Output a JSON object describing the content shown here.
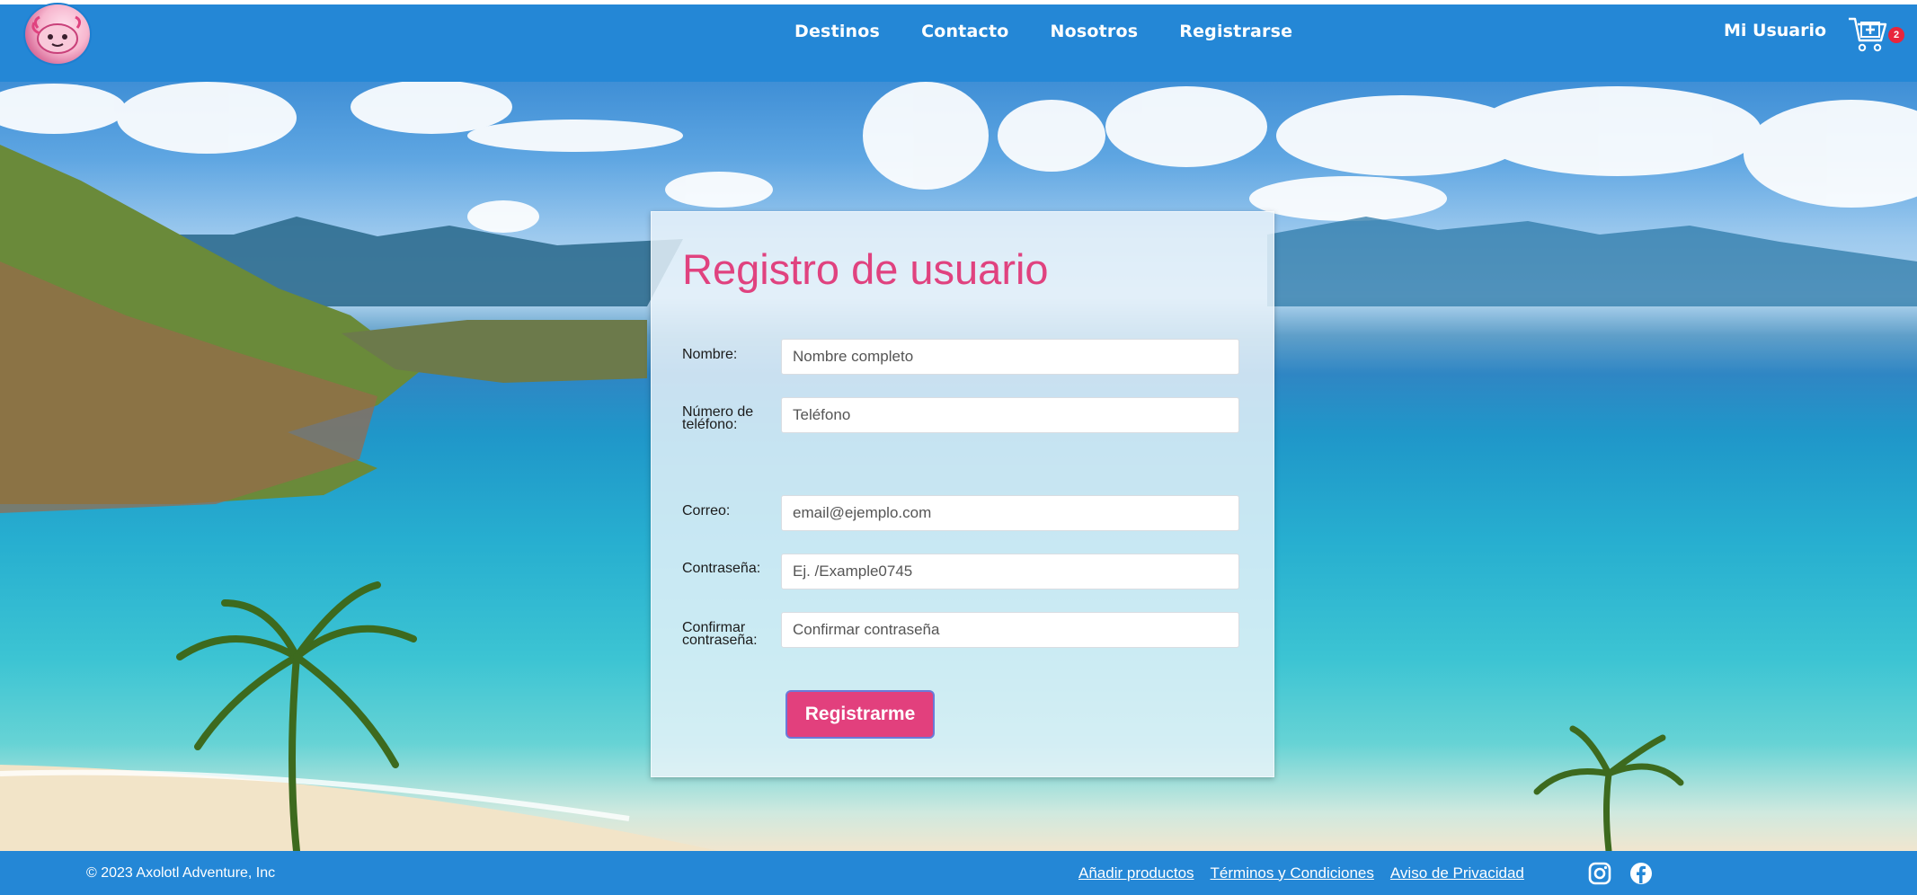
{
  "navbar": {
    "logo_icon": "axolotl-logo-icon",
    "links": [
      {
        "label": "Destinos"
      },
      {
        "label": "Contacto"
      },
      {
        "label": "Nosotros"
      },
      {
        "label": "Registrarse"
      }
    ],
    "user_label": "Mi Usuario",
    "cart_icon": "shopping-cart-icon",
    "cart_count": "2"
  },
  "form": {
    "title": "Registro de usuario",
    "fields": [
      {
        "label": "Nombre:",
        "placeholder": "Nombre completo",
        "value": ""
      },
      {
        "label": "Número de teléfono:",
        "placeholder": "Teléfono",
        "value": ""
      },
      {
        "label": "Correo:",
        "placeholder": "email@ejemplo.com",
        "value": ""
      },
      {
        "label": "Contraseña:",
        "placeholder": "Ej. /Example0745",
        "value": ""
      },
      {
        "label": "Confirmar contraseña:",
        "placeholder": "Confirmar contraseña",
        "value": ""
      }
    ],
    "submit_label": "Registrarme"
  },
  "footer": {
    "copyright": "© 2023 Axolotl Adventure, Inc",
    "links": [
      {
        "label": "Añadir productos"
      },
      {
        "label": "Términos y Condiciones"
      },
      {
        "label": "Aviso de Privacidad"
      }
    ],
    "social_icons": [
      "instagram-icon",
      "facebook-icon"
    ]
  },
  "colors": {
    "nav_blue": "#2487d6",
    "accent_pink": "#e2407d",
    "badge_red": "#e8253c"
  }
}
